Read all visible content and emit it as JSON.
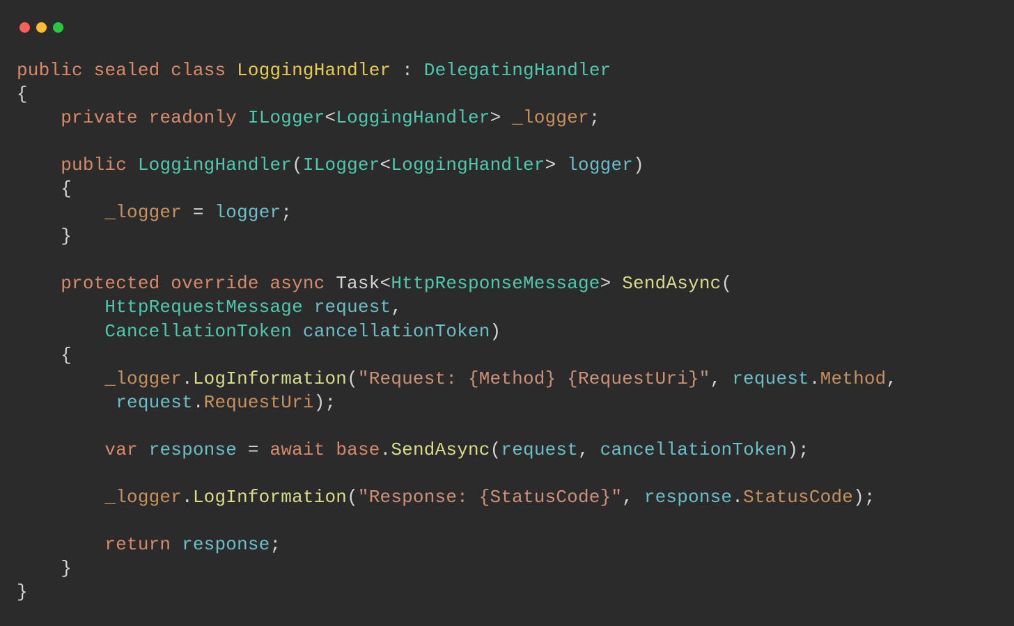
{
  "colors": {
    "bg": "#2b2b2b",
    "keyword": "#d88b6a",
    "class": "#e6cc4a",
    "type": "#4ec9b0",
    "member": "#c7915e",
    "method": "#dadc88",
    "param": "#6bbfc8",
    "string": "#ce9178",
    "default": "#d4d4d4",
    "trafficRed": "#ff5f56",
    "trafficYellow": "#ffbd2e",
    "trafficGreen": "#27c93f"
  },
  "window": {
    "redIcon": "close-icon",
    "yellowIcon": "minimize-icon",
    "greenIcon": "zoom-icon"
  },
  "code": {
    "kw_public1": "public",
    "kw_sealed": "sealed",
    "kw_class": "class",
    "cls_name": "LoggingHandler",
    "cls_base": "DelegatingHandler",
    "kw_private": "private",
    "kw_readonly": "readonly",
    "type_ilogger": "ILogger",
    "gen_logging1": "LoggingHandler",
    "fld_logger": "_logger",
    "kw_public2": "public",
    "ctor_name": "LoggingHandler",
    "type_iloggerp": "ILogger",
    "gen_logging2": "LoggingHandler",
    "par_logger": "logger",
    "assign_lhs": "_logger",
    "assign_rhs": "logger",
    "kw_protected": "protected",
    "kw_override": "override",
    "kw_async": "async",
    "id_task": "Task",
    "type_httprsp": "HttpResponseMessage",
    "mth_sendasync": "SendAsync",
    "type_httpreq": "HttpRequestMessage",
    "par_request": "request",
    "type_canceltok": "CancellationToken",
    "par_cancel": "cancellationToken",
    "mem_logger1": "_logger",
    "mth_loginfo1": "LogInformation",
    "str_req": "\"Request: {Method} {RequestUri}\"",
    "par_request2": "request",
    "mem_method": "Method",
    "par_request3": "request",
    "mem_requesturi": "RequestUri",
    "kw_var": "var",
    "id_response": "response",
    "kw_await": "await",
    "kw_base": "base",
    "mth_sendasync2": "SendAsync",
    "par_request4": "request",
    "par_cancel2": "cancellationToken",
    "mem_logger2": "_logger",
    "mth_loginfo2": "LogInformation",
    "str_rsp": "\"Response: {StatusCode}\"",
    "par_response2": "response",
    "mem_statuscode": "StatusCode",
    "kw_return": "return",
    "id_response2": "response"
  }
}
